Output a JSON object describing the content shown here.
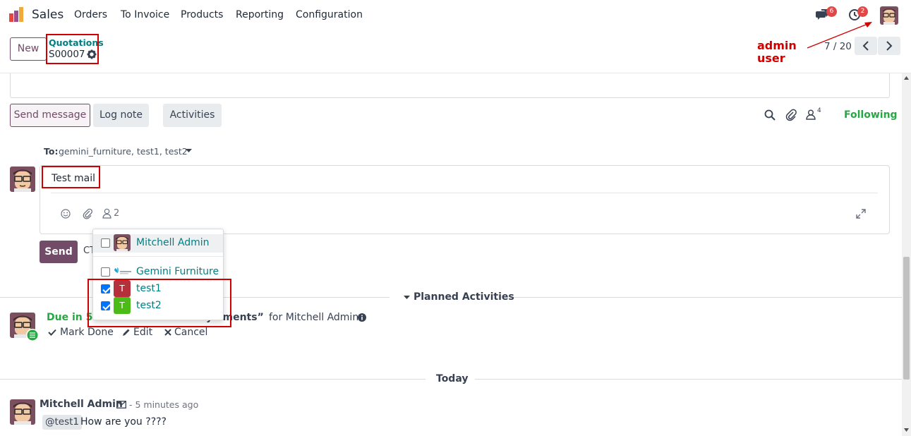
{
  "navbar": {
    "app_name": "Sales",
    "menu": [
      "Orders",
      "To Invoice",
      "Products",
      "Reporting",
      "Configuration"
    ],
    "messages_count": "6",
    "activities_count": "2"
  },
  "control_panel": {
    "new_label": "New",
    "breadcrumb_parent": "Quotations",
    "record_name": "S00007",
    "pager": "7 / 20"
  },
  "annotation": {
    "line1": "admin",
    "line2": "user"
  },
  "chatter": {
    "send_message": "Send message",
    "log_note": "Log note",
    "activities": "Activities",
    "followers_count": "4",
    "following": "Following",
    "to_label": "To:",
    "to_recipients": "gemini_furniture, test1, test2",
    "composer_text": "Test mail",
    "composer_followers_count": "2",
    "send_label": "Send",
    "send_hint": "CT"
  },
  "followers_dropdown": [
    {
      "name": "Mitchell Admin",
      "checked": false,
      "avatar": "mitchell"
    },
    {
      "name": "Gemini Furniture",
      "checked": false,
      "avatar": "gemini"
    },
    {
      "name": "test1",
      "checked": true,
      "avatar": "T",
      "color": "#b5303a"
    },
    {
      "name": "test2",
      "checked": true,
      "avatar": "T",
      "color": "#4cbb17"
    }
  ],
  "planned": {
    "header": "Planned Activities",
    "due": "Due in 5 d",
    "activity_tail": "y   ements”",
    "for_label": "for Mitchell Admin",
    "mark_done": "Mark Done",
    "edit": "Edit",
    "cancel": "Cancel"
  },
  "today": {
    "header": "Today",
    "author": "Mitchell Admin",
    "time": "- 5 minutes ago",
    "mention": "@test1",
    "body": "How are you ????"
  },
  "colors": {
    "brand": "#714b67",
    "teal": "#017e84",
    "following_green": "#28a745",
    "badge_red": "#e04747",
    "annotation_red": "#d00000"
  }
}
